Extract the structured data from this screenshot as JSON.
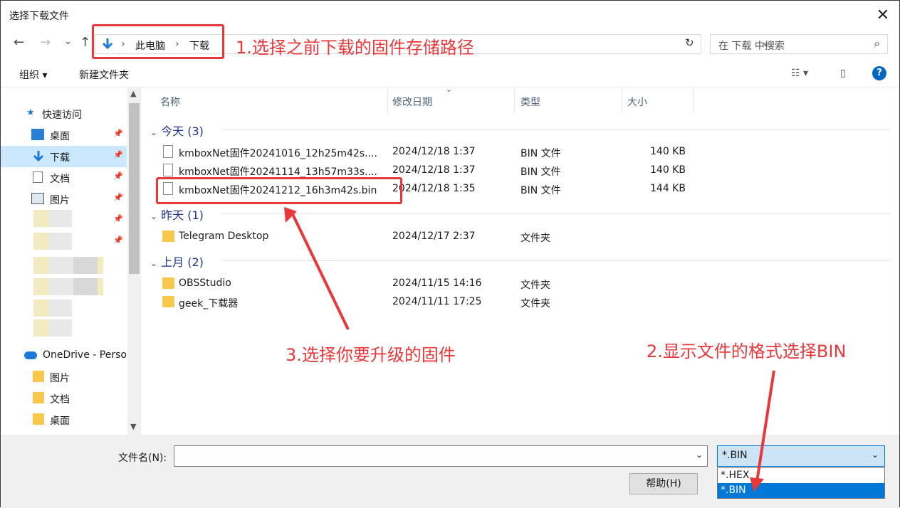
{
  "window": {
    "title": "选择下载文件",
    "close": "✕"
  },
  "nav": {
    "back": "←",
    "forward": "→",
    "recent": "⌄",
    "up": "↑",
    "breadcrumb": [
      "此电脑",
      "下载"
    ],
    "sep": "›",
    "search_placeholder": "在 下载 中搜索"
  },
  "toolbar": {
    "organize": "组织 ▾",
    "new_folder": "新建文件夹",
    "help": "?"
  },
  "sidebar": {
    "quick_access": "快速访问",
    "items": [
      {
        "label": "桌面"
      },
      {
        "label": "下载"
      },
      {
        "label": "文档"
      },
      {
        "label": "图片"
      }
    ],
    "onedrive": "OneDrive - Perso",
    "od_items": [
      {
        "label": "图片"
      },
      {
        "label": "文档"
      },
      {
        "label": "桌面"
      }
    ]
  },
  "columns": {
    "name": "名称",
    "date": "修改日期",
    "type": "类型",
    "size": "大小"
  },
  "groups": [
    {
      "label": "今天 (3)",
      "files": [
        {
          "name": "kmboxNet固件20241016_12h25m42s....",
          "date": "2024/12/18 1:37",
          "type": "BIN 文件",
          "size": "140 KB"
        },
        {
          "name": "kmboxNet固件20241114_13h57m33s....",
          "date": "2024/12/18 1:37",
          "type": "BIN 文件",
          "size": "140 KB"
        },
        {
          "name": "kmboxNet固件20241212_16h3m42s.bin",
          "date": "2024/12/18 1:35",
          "type": "BIN 文件",
          "size": "144 KB"
        }
      ]
    },
    {
      "label": "昨天 (1)",
      "files": [
        {
          "name": "Telegram Desktop",
          "date": "2024/12/17 2:37",
          "type": "文件夹",
          "size": ""
        }
      ]
    },
    {
      "label": "上月 (2)",
      "files": [
        {
          "name": "OBSStudio",
          "date": "2024/11/15 14:16",
          "type": "文件夹",
          "size": ""
        },
        {
          "name": "geek_下载器",
          "date": "2024/11/11 17:25",
          "type": "文件夹",
          "size": ""
        }
      ]
    }
  ],
  "bottom": {
    "filename_label": "文件名(N):",
    "filename_value": "",
    "filetype_value": "*.BIN",
    "filetype_options": [
      "*.HEX",
      "*.BIN"
    ],
    "help_button": "帮助(H)"
  },
  "annotations": {
    "a1": "1.选择之前下载的固件存储路径",
    "a2": "2.显示文件的格式选择BIN",
    "a3": "3.选择你要升级的固件"
  },
  "colors": {
    "annotation": "#e8383c",
    "selection": "#0078d7"
  }
}
